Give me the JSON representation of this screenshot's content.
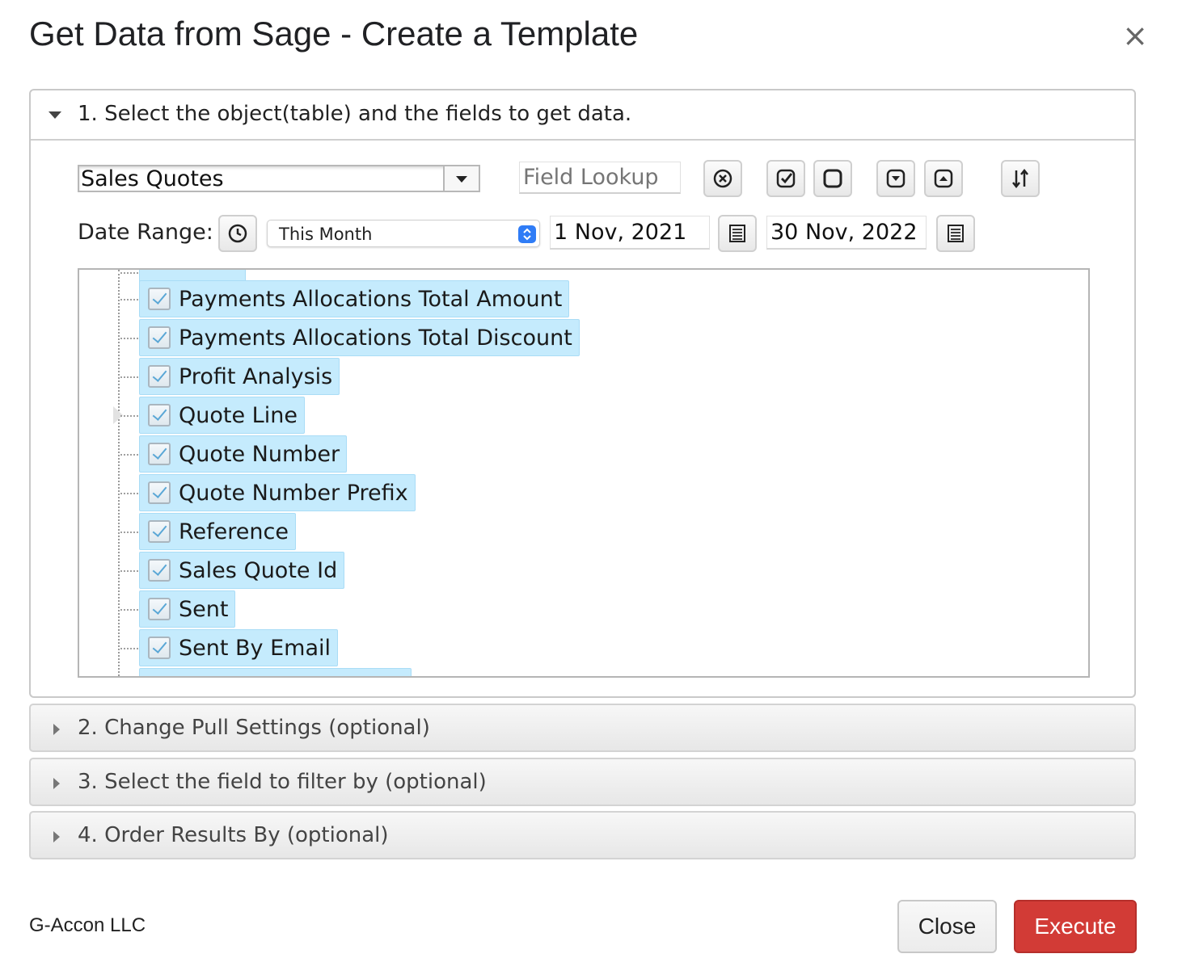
{
  "dialog": {
    "title": "Get Data from Sage - Create a Template",
    "close_icon": "×"
  },
  "section1": {
    "label": "1. Select the object(table) and the fields to get data.",
    "object_select": {
      "value": "Sales Quotes"
    },
    "field_lookup": {
      "placeholder": "Field Lookup"
    },
    "toolbar_icons": [
      "clear-circle-icon",
      "check-all-icon",
      "uncheck-all-icon",
      "expand-all-icon",
      "collapse-all-icon",
      "sort-icon"
    ],
    "date_range": {
      "label": "Date Range:",
      "preset": "This Month",
      "from": "1 Nov, 2021",
      "to": "30 Nov, 2022"
    },
    "fields": [
      {
        "label": "Payments Allocations Total Amount",
        "checked": true
      },
      {
        "label": "Payments Allocations Total Discount",
        "checked": true
      },
      {
        "label": "Profit Analysis",
        "checked": true
      },
      {
        "label": "Quote Line",
        "checked": true,
        "expandable": true
      },
      {
        "label": "Quote Number",
        "checked": true
      },
      {
        "label": "Quote Number Prefix",
        "checked": true
      },
      {
        "label": "Reference",
        "checked": true
      },
      {
        "label": "Sales Quote Id",
        "checked": true
      },
      {
        "label": "Sent",
        "checked": true
      },
      {
        "label": "Sent By Email",
        "checked": true
      }
    ]
  },
  "section2": {
    "label": "2. Change Pull Settings (optional)"
  },
  "section3": {
    "label": "3. Select the field to filter by (optional)"
  },
  "section4": {
    "label": "4. Order Results By (optional)"
  },
  "footer": {
    "company": "G-Accon LLC",
    "close_label": "Close",
    "execute_label": "Execute"
  },
  "colors": {
    "selected_item_bg": "#c5ebfd",
    "execute_bg": "#d23b36",
    "stepper_blue": "#2f7cf6"
  }
}
